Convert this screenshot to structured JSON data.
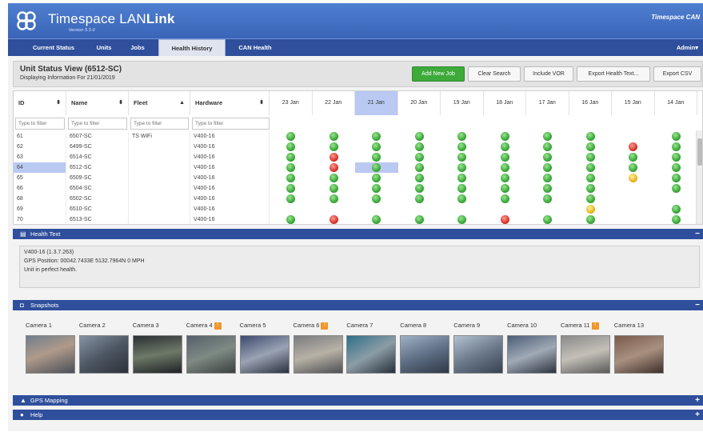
{
  "app": {
    "brand_prefix": "Timespace LAN",
    "brand_suffix": "Link",
    "version": "Version 5.5.0",
    "corner_brand": "Timespace CAN"
  },
  "nav": {
    "items": [
      {
        "label": "Current Status",
        "active": false
      },
      {
        "label": "Units",
        "active": false
      },
      {
        "label": "Jobs",
        "active": false
      },
      {
        "label": "Health History",
        "active": true
      },
      {
        "label": "CAN Health",
        "active": false
      }
    ],
    "admin_label": "Admin▾"
  },
  "view": {
    "title": "Unit Status View (6512-SC)",
    "subtitle": "Displaying Information For 21/01/2019",
    "buttons": {
      "add_job": "Add New Job",
      "clear_search": "Clear Search",
      "include_vor": "Include VOR",
      "export_health": "Export Health Text...",
      "export_csv": "Export CSV"
    }
  },
  "grid": {
    "columns": {
      "id": "ID",
      "name": "Name",
      "fleet": "Fleet",
      "hardware": "Hardware"
    },
    "sort_icons": {
      "id": "⬍",
      "name": "⬍",
      "fleet": "▲",
      "hardware": "⬍"
    },
    "filter_placeholder": "Type to filter",
    "dates": [
      "23 Jan",
      "22 Jan",
      "21 Jan",
      "20 Jan",
      "19 Jan",
      "18 Jan",
      "17 Jan",
      "16 Jan",
      "15 Jan",
      "14 Jan"
    ],
    "active_date_index": 2,
    "selected_row_index": 3,
    "rows": [
      {
        "id": "61",
        "name": "6507-SC",
        "fleet": "TS WiFi",
        "hardware": "V400-16",
        "status": [
          "g",
          "g",
          "g",
          "g",
          "g",
          "g",
          "g",
          "g",
          "",
          "g"
        ]
      },
      {
        "id": "62",
        "name": "6499-SC",
        "fleet": "",
        "hardware": "V400-16",
        "status": [
          "g",
          "g",
          "g",
          "g",
          "g",
          "g",
          "g",
          "g",
          "r",
          "g"
        ]
      },
      {
        "id": "63",
        "name": "6514-SC",
        "fleet": "",
        "hardware": "V400-16",
        "status": [
          "g",
          "r",
          "g",
          "g",
          "g",
          "g",
          "g",
          "g",
          "g",
          "g"
        ]
      },
      {
        "id": "64",
        "name": "6512-SC",
        "fleet": "",
        "hardware": "V400-16",
        "status": [
          "g",
          "r",
          "g",
          "g",
          "g",
          "g",
          "g",
          "g",
          "g",
          "g"
        ]
      },
      {
        "id": "65",
        "name": "6509-SC",
        "fleet": "",
        "hardware": "V400-16",
        "status": [
          "g",
          "g",
          "g",
          "g",
          "g",
          "g",
          "g",
          "g",
          "y",
          "g"
        ]
      },
      {
        "id": "66",
        "name": "6504-SC",
        "fleet": "",
        "hardware": "V400-16",
        "status": [
          "g",
          "g",
          "g",
          "g",
          "g",
          "g",
          "g",
          "g",
          "",
          "g"
        ]
      },
      {
        "id": "68",
        "name": "6502-SC",
        "fleet": "",
        "hardware": "V400-16",
        "status": [
          "g",
          "g",
          "g",
          "g",
          "g",
          "g",
          "g",
          "g",
          "",
          ""
        ]
      },
      {
        "id": "69",
        "name": "6510-SC",
        "fleet": "",
        "hardware": "V400-16",
        "status": [
          "",
          "",
          "",
          "",
          "",
          "",
          "",
          "y",
          "",
          "g"
        ]
      },
      {
        "id": "70",
        "name": "6513-SC",
        "fleet": "",
        "hardware": "V400-16",
        "status": [
          "g",
          "r",
          "g",
          "g",
          "g",
          "r",
          "g",
          "g",
          "",
          "g"
        ]
      }
    ],
    "status_colors": {
      "g": "#3aa83a",
      "r": "#d8362e",
      "y": "#e8b820"
    }
  },
  "health_section": {
    "title": "Health Text",
    "toggle": "−",
    "lines": [
      "V400-16 (1.3.7.263)",
      "GPS Position: 00042.7433E      5132.7964N   0 MPH",
      "Unit in perfect health."
    ]
  },
  "snapshots_section": {
    "title": "Snapshots",
    "toggle": "−",
    "cameras": [
      {
        "label": "Camera 1",
        "badge": ""
      },
      {
        "label": "Camera 2",
        "badge": ""
      },
      {
        "label": "Camera 3",
        "badge": ""
      },
      {
        "label": "Camera 4",
        "badge": "!"
      },
      {
        "label": "Camera 5",
        "badge": ""
      },
      {
        "label": "Camera 6",
        "badge": "!"
      },
      {
        "label": "Camera 7",
        "badge": ""
      },
      {
        "label": "Camera 8",
        "badge": ""
      },
      {
        "label": "Camera 9",
        "badge": ""
      },
      {
        "label": "Camera 10",
        "badge": ""
      },
      {
        "label": "Camera 11",
        "badge": "!"
      },
      {
        "label": "Camera 13",
        "badge": ""
      }
    ]
  },
  "gps_section": {
    "title": "GPS Mapping",
    "toggle": "+"
  },
  "help_section": {
    "title": "Help",
    "toggle": "+"
  },
  "colors": {
    "header_blue": "#3a64b7",
    "nav_blue": "#2f4f9c",
    "accent_green": "#3eaa3a",
    "selection": "#b9c9f2"
  }
}
